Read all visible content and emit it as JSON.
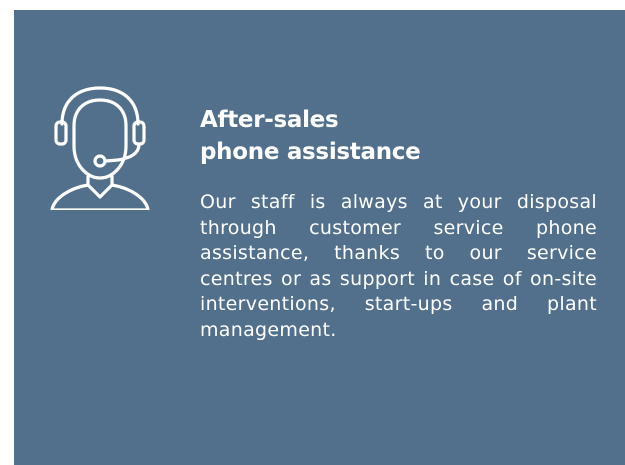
{
  "card": {
    "title_line1": "After-sales",
    "title_line2": "phone assistance",
    "body": "Our staff is always at your disposal through customer service phone assistance, thanks to our service centres or as support in case of on-site interventions, start-ups and plant management.",
    "icon": "customer-support-headset-icon"
  },
  "colors": {
    "background": "#52708c",
    "text": "#ffffff"
  }
}
